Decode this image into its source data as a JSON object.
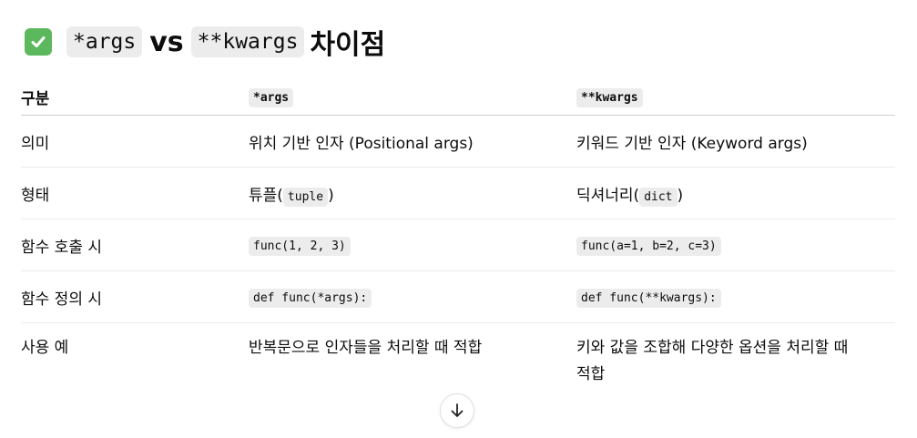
{
  "heading": {
    "icon": "check-mark-icon",
    "part1": "*args",
    "part2": "vs",
    "part3": "**kwargs",
    "part4": "차이점"
  },
  "table": {
    "headers": [
      "구분",
      "*args",
      "**kwargs"
    ],
    "rows": [
      {
        "label": "의미",
        "args": "위치 기반 인자 (Positional args)",
        "kwargs": "키워드 기반 인자 (Keyword args)"
      },
      {
        "label": "형태",
        "args_pre": "튜플(",
        "args_code": "tuple",
        "args_post": ")",
        "kwargs_pre": "딕셔너리(",
        "kwargs_code": "dict",
        "kwargs_post": ")"
      },
      {
        "label": "함수 호출 시",
        "args_code": "func(1, 2, 3)",
        "kwargs_code": "func(a=1, b=2, c=3)"
      },
      {
        "label": "함수 정의 시",
        "args_code": "def func(*args):",
        "kwargs_code": "def func(**kwargs):"
      },
      {
        "label": "사용 예",
        "args": "반복문으로 인자들을 처리할 때 적합",
        "kwargs_line1": "키와 값을 조합해 다양한 옵션을 처리할 때",
        "kwargs_line2": "적합"
      }
    ]
  },
  "scroll_icon": "arrow-down-icon",
  "colors": {
    "check": "#5cb85c",
    "code_bg": "#ececec"
  }
}
